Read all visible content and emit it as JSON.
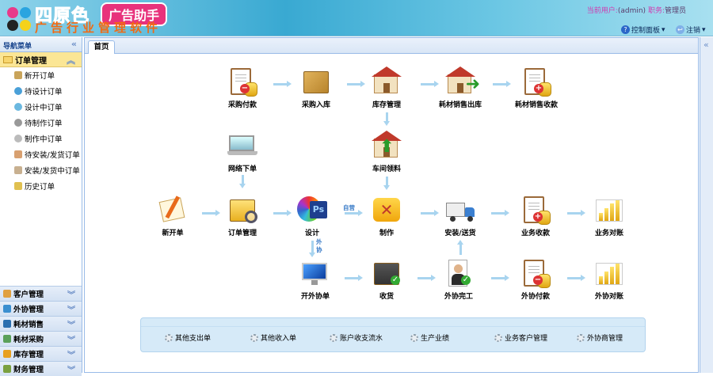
{
  "header": {
    "logo_main": "四原色",
    "logo_badge": "广告助手",
    "logo_sub": "广告行业管理软件",
    "current_user_label": "当前用户:",
    "current_user": "(admin)",
    "role_label": "职务:",
    "role": "管理员",
    "control_panel": "控制面板",
    "logout": "注销"
  },
  "sidebar": {
    "title": "导航菜单",
    "open_group": "订单管理",
    "items": [
      "新开订单",
      "待设计订单",
      "设计中订单",
      "待制作订单",
      "制作中订单",
      "待安装/发货订单",
      "安装/发货中订单",
      "历史订单"
    ],
    "groups": [
      "客户管理",
      "外协管理",
      "耗材销售",
      "耗材采购",
      "库存管理",
      "财务管理"
    ]
  },
  "tabs": [
    "首页"
  ],
  "flow": {
    "purchase_pay": "采购付款",
    "purchase_in": "采购入库",
    "stock": "库存管理",
    "consumable_out": "耗材销售出库",
    "consumable_collect": "耗材销售收款",
    "online_order": "网络下单",
    "workshop_pick": "车间领料",
    "new_order": "新开单",
    "order_manage": "订单管理",
    "design": "设计",
    "produce": "制作",
    "install": "安装/送货",
    "biz_collect": "业务收款",
    "biz_reconcile": "业务对账",
    "outsource_open": "开外协单",
    "receive": "收货",
    "outsource_done": "外协完工",
    "outsource_pay": "外协付款",
    "outsource_reconcile": "外协对账",
    "self_label": "自营",
    "outsource_label": "外协"
  },
  "quick_links": [
    "其他支出单",
    "其他收入单",
    "账户收支流水",
    "生产业绩",
    "业务客户管理",
    "外协商管理"
  ]
}
